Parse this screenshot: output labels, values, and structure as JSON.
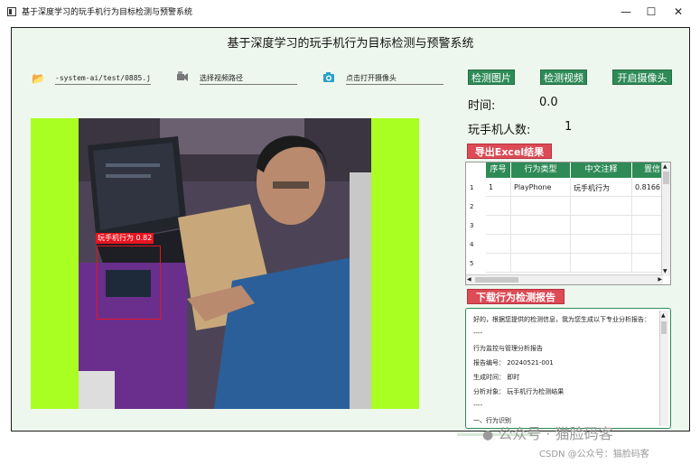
{
  "window": {
    "title": "基于深度学习的玩手机行为目标检测与预警系统",
    "minimize": "—",
    "maximize": "☐",
    "close": "✕"
  },
  "app": {
    "title": "基于深度学习的玩手机行为目标检测与预警系统"
  },
  "inputs": {
    "image_path": "-system-ai/test/0885.jpg",
    "video_path": "选择视频路径",
    "camera": "点击打开摄像头"
  },
  "buttons": {
    "detect_image": "检测图片",
    "detect_video": "检测视频",
    "open_camera": "开启摄像头",
    "export_excel": "导出Excel结果",
    "download_report": "下载行为检测报告"
  },
  "stats": {
    "time_label": "时间:",
    "time_value": "0.0",
    "count_label": "玩手机人数:",
    "count_value": "1"
  },
  "detection": {
    "label": "玩手机行为 0.82"
  },
  "table": {
    "headers": [
      "序号",
      "行为类型",
      "中文注释",
      "置信"
    ],
    "row_numbers": [
      "1",
      "2",
      "3",
      "4",
      "5"
    ],
    "rows": [
      [
        "1",
        "PlayPhone",
        "玩手机行为",
        "0.8166"
      ]
    ]
  },
  "report": {
    "lines": [
      "好的，根据您提供的检测信息，我为您生成以下专业分析报告：",
      "----",
      "行为监控与管理分析报告",
      "报告编号： 20240521-001",
      "生成时间： 即时",
      "分析对象： 玩手机行为检测结果",
      "----",
      "一、行为识别"
    ]
  },
  "watermark": {
    "line1": "公众号 · 猫脸码客",
    "line2": "CSDN @公众号：猫脸码客"
  },
  "colors": {
    "accent_green": "#2e8b57",
    "accent_red": "#dc4b56",
    "detection_red": "#e8131f",
    "video_bg": "#aaff22",
    "panel_bg": "#eef7ee"
  }
}
